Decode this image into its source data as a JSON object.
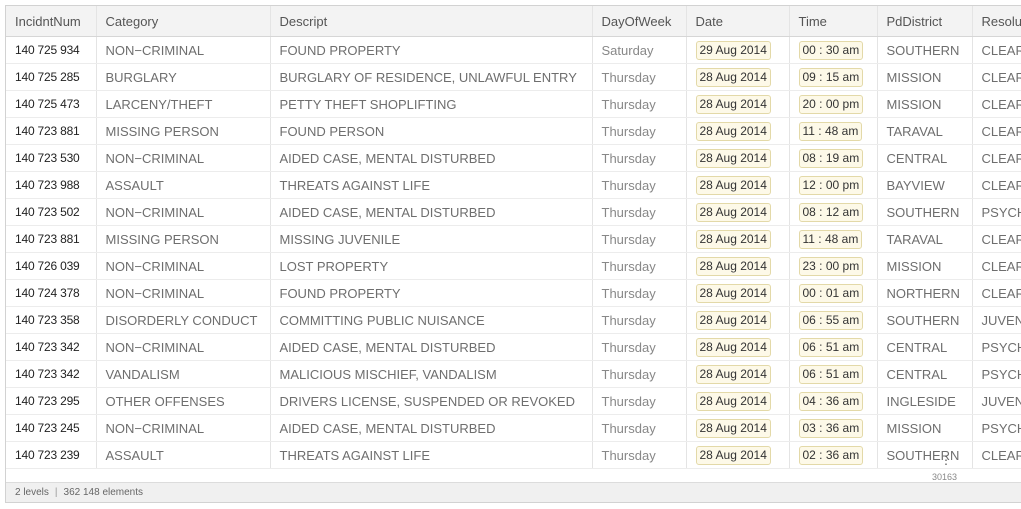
{
  "columns": [
    "IncidntNum",
    "Category",
    "Descript",
    "DayOfWeek",
    "Date",
    "Time",
    "PdDistrict",
    "Resolut"
  ],
  "rows": [
    {
      "num": "140 725 934",
      "cat": "NON−CRIMINAL",
      "desc": "FOUND PROPERTY",
      "dow": "Saturday",
      "date": "29 Aug 2014",
      "time": "00 : 30 am",
      "dist": "SOUTHERN",
      "res": "CLEAR"
    },
    {
      "num": "140 725 285",
      "cat": "BURGLARY",
      "desc": "BURGLARY OF RESIDENCE, UNLAWFUL ENTRY",
      "dow": "Thursday",
      "date": "28 Aug 2014",
      "time": "09 : 15 am",
      "dist": "MISSION",
      "res": "CLEAR"
    },
    {
      "num": "140 725 473",
      "cat": "LARCENY/THEFT",
      "desc": "PETTY THEFT SHOPLIFTING",
      "dow": "Thursday",
      "date": "28 Aug 2014",
      "time": "20 : 00 pm",
      "dist": "MISSION",
      "res": "CLEAR"
    },
    {
      "num": "140 723 881",
      "cat": "MISSING PERSON",
      "desc": "FOUND PERSON",
      "dow": "Thursday",
      "date": "28 Aug 2014",
      "time": "11 : 48 am",
      "dist": "TARAVAL",
      "res": "CLEAR"
    },
    {
      "num": "140 723 530",
      "cat": "NON−CRIMINAL",
      "desc": "AIDED CASE, MENTAL DISTURBED",
      "dow": "Thursday",
      "date": "28 Aug 2014",
      "time": "08 : 19 am",
      "dist": "CENTRAL",
      "res": "CLEAR"
    },
    {
      "num": "140 723 988",
      "cat": "ASSAULT",
      "desc": "THREATS AGAINST LIFE",
      "dow": "Thursday",
      "date": "28 Aug 2014",
      "time": "12 : 00 pm",
      "dist": "BAYVIEW",
      "res": "CLEAR"
    },
    {
      "num": "140 723 502",
      "cat": "NON−CRIMINAL",
      "desc": "AIDED CASE, MENTAL DISTURBED",
      "dow": "Thursday",
      "date": "28 Aug 2014",
      "time": "08 : 12 am",
      "dist": "SOUTHERN",
      "res": "PSYCH"
    },
    {
      "num": "140 723 881",
      "cat": "MISSING PERSON",
      "desc": "MISSING JUVENILE",
      "dow": "Thursday",
      "date": "28 Aug 2014",
      "time": "11 : 48 am",
      "dist": "TARAVAL",
      "res": "CLEAR"
    },
    {
      "num": "140 726 039",
      "cat": "NON−CRIMINAL",
      "desc": "LOST PROPERTY",
      "dow": "Thursday",
      "date": "28 Aug 2014",
      "time": "23 : 00 pm",
      "dist": "MISSION",
      "res": "CLEAR"
    },
    {
      "num": "140 724 378",
      "cat": "NON−CRIMINAL",
      "desc": "FOUND PROPERTY",
      "dow": "Thursday",
      "date": "28 Aug 2014",
      "time": "00 : 01 am",
      "dist": "NORTHERN",
      "res": "CLEAR"
    },
    {
      "num": "140 723 358",
      "cat": "DISORDERLY CONDUCT",
      "desc": "COMMITTING PUBLIC NUISANCE",
      "dow": "Thursday",
      "date": "28 Aug 2014",
      "time": "06 : 55 am",
      "dist": "SOUTHERN",
      "res": "JUVEN"
    },
    {
      "num": "140 723 342",
      "cat": "NON−CRIMINAL",
      "desc": "AIDED CASE, MENTAL DISTURBED",
      "dow": "Thursday",
      "date": "28 Aug 2014",
      "time": "06 : 51 am",
      "dist": "CENTRAL",
      "res": "PSYCH"
    },
    {
      "num": "140 723 342",
      "cat": "VANDALISM",
      "desc": "MALICIOUS MISCHIEF, VANDALISM",
      "dow": "Thursday",
      "date": "28 Aug 2014",
      "time": "06 : 51 am",
      "dist": "CENTRAL",
      "res": "PSYCH"
    },
    {
      "num": "140 723 295",
      "cat": "OTHER OFFENSES",
      "desc": "DRIVERS LICENSE, SUSPENDED OR REVOKED",
      "dow": "Thursday",
      "date": "28 Aug 2014",
      "time": "04 : 36 am",
      "dist": "INGLESIDE",
      "res": "JUVEN"
    },
    {
      "num": "140 723 245",
      "cat": "NON−CRIMINAL",
      "desc": "AIDED CASE, MENTAL DISTURBED",
      "dow": "Thursday",
      "date": "28 Aug 2014",
      "time": "03 : 36 am",
      "dist": "MISSION",
      "res": "PSYCH"
    },
    {
      "num": "140 723 239",
      "cat": "ASSAULT",
      "desc": "THREATS AGAINST LIFE",
      "dow": "Thursday",
      "date": "28 Aug 2014",
      "time": "02 : 36 am",
      "dist": "SOUTHERN",
      "res": "CLEAR"
    }
  ],
  "more_indicator": "⋮",
  "row_count": "30163",
  "status": {
    "levels": "2 levels",
    "elements": "362 148 elements"
  },
  "colors": {
    "chip_bg": "#fdf9e8",
    "chip_border": "#e3d9a8",
    "header_bg": "#f3f3f3"
  }
}
